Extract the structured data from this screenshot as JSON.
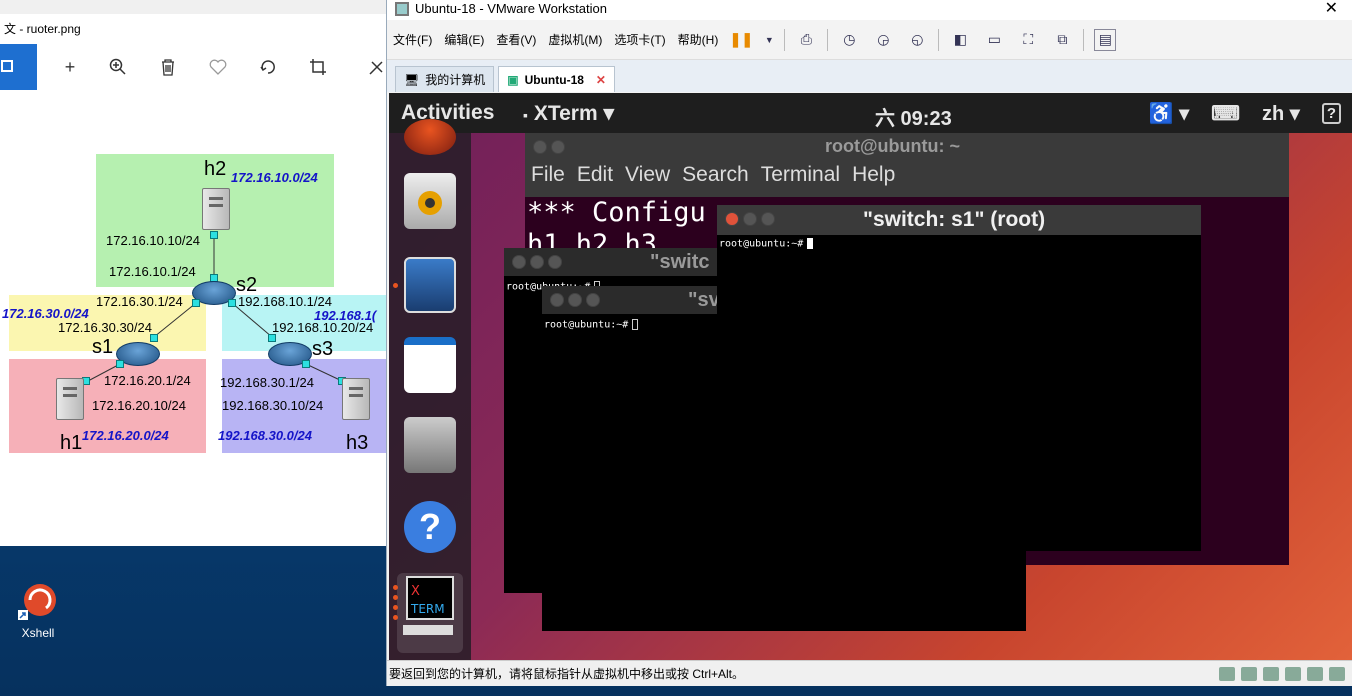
{
  "desktop": {
    "xshell_label": "Xshell"
  },
  "photos": {
    "title": "文 - ruoter.png",
    "toolbar_icons": [
      "image-icon",
      "add-icon",
      "zoom-in-icon",
      "delete-icon",
      "favorite-icon",
      "rotate-icon",
      "crop-icon",
      "edit-icon"
    ],
    "diagram": {
      "h2": "h2",
      "h1": "h1",
      "h3": "h3",
      "s1": "s1",
      "s2": "s2",
      "s3": "s3",
      "net_h2": "172.16.10.0/24",
      "net_left": "172.16.30.0/24",
      "net_right": "192.168.1(",
      "net_h1": "172.16.20.0/24",
      "net_h3": "192.168.30.0/24",
      "ip_h2": "172.16.10.10/24",
      "ip_s2_top": "172.16.10.1/24",
      "ip_s2_left": "172.16.30.1/24",
      "ip_s2_right": "192.168.10.1/24",
      "ip_s1_top": "172.16.30.30/24",
      "ip_s3_top": "192.168.10.20/24",
      "ip_s1_bottom": "172.16.20.1/24",
      "ip_h1": "172.16.20.10/24",
      "ip_s3_bottom": "192.168.30.1/24",
      "ip_h3": "192.168.30.10/24"
    }
  },
  "vmware": {
    "title": "Ubuntu-18 - VMware Workstation",
    "menu": [
      "文件(F)",
      "编辑(E)",
      "查看(V)",
      "虚拟机(M)",
      "选项卡(T)",
      "帮助(H)"
    ],
    "tabs": [
      {
        "label": "我的计算机"
      },
      {
        "label": "Ubuntu-18"
      }
    ],
    "status": "要返回到您的计算机，请将鼠标指针从虚拟机中移出或按 Ctrl+Alt。"
  },
  "ubuntu": {
    "activities": "Activities",
    "app": "XTerm ▾",
    "clock": "六 09:23",
    "lang": "zh ▾",
    "terminal_main": {
      "title": "root@ubuntu: ~",
      "menu": [
        "File",
        "Edit",
        "View",
        "Search",
        "Terminal",
        "Help"
      ],
      "line1": "*** Configu",
      "line2": "h1 h2 h3"
    },
    "xterm_s1": {
      "title": "\"switch: s1\" (root)",
      "prompt": "root@ubuntu:~#"
    },
    "xterm_a": {
      "title": "\"switc",
      "prompt": "root@ubuntu:~#"
    },
    "xterm_b": {
      "title": "\"sv",
      "prompt": "root@ubuntu:~#"
    }
  }
}
